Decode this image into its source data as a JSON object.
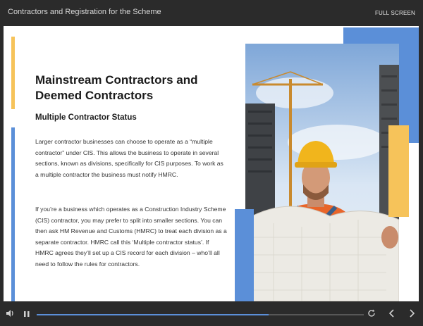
{
  "header": {
    "course_title": "Contractors and Registration for the Scheme",
    "fullscreen_label": "FULL SCREEN"
  },
  "slide": {
    "heading_line1": "Mainstream Contractors and",
    "heading_line2": "Deemed Contractors",
    "subheading": "Multiple Contractor Status",
    "paragraph1": "Larger contractor businesses can choose to operate as a “multiple contractor” under CIS. This allows the business to operate in several sections, known as divisions, specifically for CIS purposes. To work as a multiple contractor the business must notify HMRC.",
    "paragraph2": "If you’re a business which operates as a Construction Industry Scheme (CIS) contractor, you may prefer to split into smaller sections. You can then ask HM Revenue and Customs (HMRC) to treat each division as a separate contractor. HMRC call this ‘Multiple contractor status’. If HMRC agrees they’ll set up a CIS record for each division – who’ll all need to follow the rules for contractors."
  },
  "player": {
    "progress_fraction": 0.71
  },
  "colors": {
    "accent_yellow": "#f6c35a",
    "accent_blue": "#5b8fd8",
    "background_dark": "#2b2b2b"
  },
  "icons": {
    "volume": "volume-icon",
    "pause": "pause-icon",
    "replay": "replay-icon",
    "prev": "chevron-left-icon",
    "next": "chevron-right-icon"
  }
}
